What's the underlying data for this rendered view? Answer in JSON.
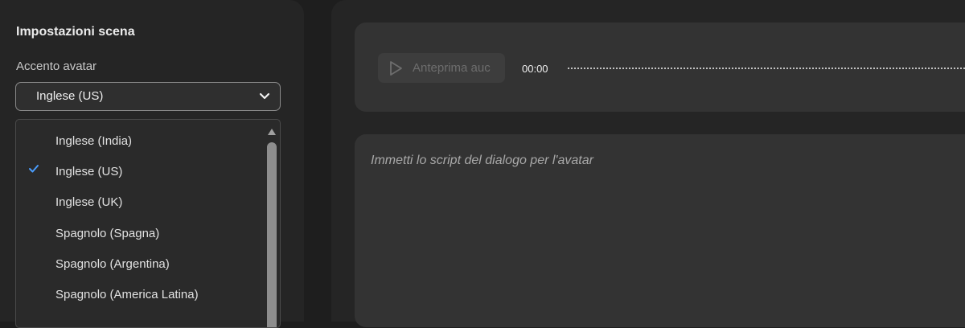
{
  "scene_settings": {
    "title": "Impostazioni scena",
    "accent_label": "Accento avatar",
    "accent_selected": "Inglese (US)"
  },
  "accent_dropdown": {
    "options": [
      {
        "label": "Inglese (India)",
        "checked": false
      },
      {
        "label": "Inglese (US)",
        "checked": true
      },
      {
        "label": "Inglese (UK)",
        "checked": false
      },
      {
        "label": "Spagnolo (Spagna)",
        "checked": false
      },
      {
        "label": "Spagnolo (Argentina)",
        "checked": false
      },
      {
        "label": "Spagnolo (America Latina)",
        "checked": false
      }
    ],
    "check_color": "#4a9eff"
  },
  "audio": {
    "preview_label": "Anteprima auc",
    "time": "00:00"
  },
  "script": {
    "placeholder": "Immetti lo script del dialogo per l'avatar"
  },
  "icons": {
    "select": "chevron-down-icon",
    "check": "checkmark-icon",
    "preview": "play-icon",
    "scroll": "scroll-up-arrow-icon"
  }
}
